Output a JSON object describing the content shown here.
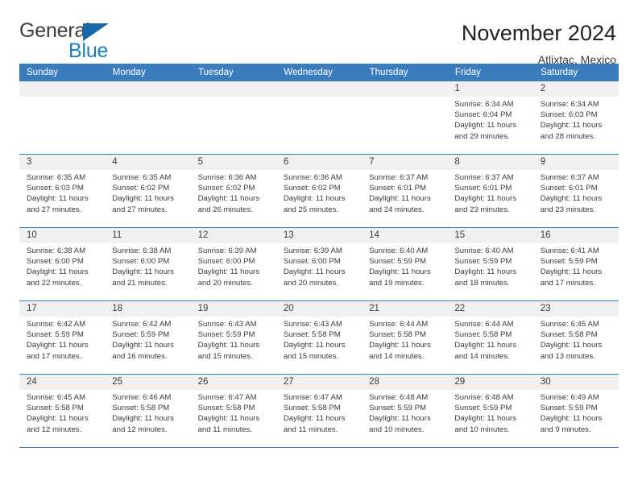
{
  "brand": {
    "name_part1": "General",
    "name_part2": "Blue",
    "accent_color": "#1b7fc4",
    "header_color": "#3b7cbd"
  },
  "header": {
    "title": "November 2024",
    "subtitle": "Atlixtac, Mexico"
  },
  "weekday_headers": [
    "Sunday",
    "Monday",
    "Tuesday",
    "Wednesday",
    "Thursday",
    "Friday",
    "Saturday"
  ],
  "weeks": [
    [
      {
        "date": "",
        "empty": true
      },
      {
        "date": "",
        "empty": true
      },
      {
        "date": "",
        "empty": true
      },
      {
        "date": "",
        "empty": true
      },
      {
        "date": "",
        "empty": true
      },
      {
        "date": "1",
        "sunrise": "Sunrise: 6:34 AM",
        "sunset": "Sunset: 6:04 PM",
        "daylight_line1": "Daylight: 11 hours",
        "daylight_line2": "and 29 minutes."
      },
      {
        "date": "2",
        "sunrise": "Sunrise: 6:34 AM",
        "sunset": "Sunset: 6:03 PM",
        "daylight_line1": "Daylight: 11 hours",
        "daylight_line2": "and 28 minutes."
      }
    ],
    [
      {
        "date": "3",
        "sunrise": "Sunrise: 6:35 AM",
        "sunset": "Sunset: 6:03 PM",
        "daylight_line1": "Daylight: 11 hours",
        "daylight_line2": "and 27 minutes."
      },
      {
        "date": "4",
        "sunrise": "Sunrise: 6:35 AM",
        "sunset": "Sunset: 6:02 PM",
        "daylight_line1": "Daylight: 11 hours",
        "daylight_line2": "and 27 minutes."
      },
      {
        "date": "5",
        "sunrise": "Sunrise: 6:36 AM",
        "sunset": "Sunset: 6:02 PM",
        "daylight_line1": "Daylight: 11 hours",
        "daylight_line2": "and 26 minutes."
      },
      {
        "date": "6",
        "sunrise": "Sunrise: 6:36 AM",
        "sunset": "Sunset: 6:02 PM",
        "daylight_line1": "Daylight: 11 hours",
        "daylight_line2": "and 25 minutes."
      },
      {
        "date": "7",
        "sunrise": "Sunrise: 6:37 AM",
        "sunset": "Sunset: 6:01 PM",
        "daylight_line1": "Daylight: 11 hours",
        "daylight_line2": "and 24 minutes."
      },
      {
        "date": "8",
        "sunrise": "Sunrise: 6:37 AM",
        "sunset": "Sunset: 6:01 PM",
        "daylight_line1": "Daylight: 11 hours",
        "daylight_line2": "and 23 minutes."
      },
      {
        "date": "9",
        "sunrise": "Sunrise: 6:37 AM",
        "sunset": "Sunset: 6:01 PM",
        "daylight_line1": "Daylight: 11 hours",
        "daylight_line2": "and 23 minutes."
      }
    ],
    [
      {
        "date": "10",
        "sunrise": "Sunrise: 6:38 AM",
        "sunset": "Sunset: 6:00 PM",
        "daylight_line1": "Daylight: 11 hours",
        "daylight_line2": "and 22 minutes."
      },
      {
        "date": "11",
        "sunrise": "Sunrise: 6:38 AM",
        "sunset": "Sunset: 6:00 PM",
        "daylight_line1": "Daylight: 11 hours",
        "daylight_line2": "and 21 minutes."
      },
      {
        "date": "12",
        "sunrise": "Sunrise: 6:39 AM",
        "sunset": "Sunset: 6:00 PM",
        "daylight_line1": "Daylight: 11 hours",
        "daylight_line2": "and 20 minutes."
      },
      {
        "date": "13",
        "sunrise": "Sunrise: 6:39 AM",
        "sunset": "Sunset: 6:00 PM",
        "daylight_line1": "Daylight: 11 hours",
        "daylight_line2": "and 20 minutes."
      },
      {
        "date": "14",
        "sunrise": "Sunrise: 6:40 AM",
        "sunset": "Sunset: 5:59 PM",
        "daylight_line1": "Daylight: 11 hours",
        "daylight_line2": "and 19 minutes."
      },
      {
        "date": "15",
        "sunrise": "Sunrise: 6:40 AM",
        "sunset": "Sunset: 5:59 PM",
        "daylight_line1": "Daylight: 11 hours",
        "daylight_line2": "and 18 minutes."
      },
      {
        "date": "16",
        "sunrise": "Sunrise: 6:41 AM",
        "sunset": "Sunset: 5:59 PM",
        "daylight_line1": "Daylight: 11 hours",
        "daylight_line2": "and 17 minutes."
      }
    ],
    [
      {
        "date": "17",
        "sunrise": "Sunrise: 6:42 AM",
        "sunset": "Sunset: 5:59 PM",
        "daylight_line1": "Daylight: 11 hours",
        "daylight_line2": "and 17 minutes."
      },
      {
        "date": "18",
        "sunrise": "Sunrise: 6:42 AM",
        "sunset": "Sunset: 5:59 PM",
        "daylight_line1": "Daylight: 11 hours",
        "daylight_line2": "and 16 minutes."
      },
      {
        "date": "19",
        "sunrise": "Sunrise: 6:43 AM",
        "sunset": "Sunset: 5:59 PM",
        "daylight_line1": "Daylight: 11 hours",
        "daylight_line2": "and 15 minutes."
      },
      {
        "date": "20",
        "sunrise": "Sunrise: 6:43 AM",
        "sunset": "Sunset: 5:58 PM",
        "daylight_line1": "Daylight: 11 hours",
        "daylight_line2": "and 15 minutes."
      },
      {
        "date": "21",
        "sunrise": "Sunrise: 6:44 AM",
        "sunset": "Sunset: 5:58 PM",
        "daylight_line1": "Daylight: 11 hours",
        "daylight_line2": "and 14 minutes."
      },
      {
        "date": "22",
        "sunrise": "Sunrise: 6:44 AM",
        "sunset": "Sunset: 5:58 PM",
        "daylight_line1": "Daylight: 11 hours",
        "daylight_line2": "and 14 minutes."
      },
      {
        "date": "23",
        "sunrise": "Sunrise: 6:45 AM",
        "sunset": "Sunset: 5:58 PM",
        "daylight_line1": "Daylight: 11 hours",
        "daylight_line2": "and 13 minutes."
      }
    ],
    [
      {
        "date": "24",
        "sunrise": "Sunrise: 6:45 AM",
        "sunset": "Sunset: 5:58 PM",
        "daylight_line1": "Daylight: 11 hours",
        "daylight_line2": "and 12 minutes."
      },
      {
        "date": "25",
        "sunrise": "Sunrise: 6:46 AM",
        "sunset": "Sunset: 5:58 PM",
        "daylight_line1": "Daylight: 11 hours",
        "daylight_line2": "and 12 minutes."
      },
      {
        "date": "26",
        "sunrise": "Sunrise: 6:47 AM",
        "sunset": "Sunset: 5:58 PM",
        "daylight_line1": "Daylight: 11 hours",
        "daylight_line2": "and 11 minutes."
      },
      {
        "date": "27",
        "sunrise": "Sunrise: 6:47 AM",
        "sunset": "Sunset: 5:58 PM",
        "daylight_line1": "Daylight: 11 hours",
        "daylight_line2": "and 11 minutes."
      },
      {
        "date": "28",
        "sunrise": "Sunrise: 6:48 AM",
        "sunset": "Sunset: 5:59 PM",
        "daylight_line1": "Daylight: 11 hours",
        "daylight_line2": "and 10 minutes."
      },
      {
        "date": "29",
        "sunrise": "Sunrise: 6:48 AM",
        "sunset": "Sunset: 5:59 PM",
        "daylight_line1": "Daylight: 11 hours",
        "daylight_line2": "and 10 minutes."
      },
      {
        "date": "30",
        "sunrise": "Sunrise: 6:49 AM",
        "sunset": "Sunset: 5:59 PM",
        "daylight_line1": "Daylight: 11 hours",
        "daylight_line2": "and 9 minutes."
      }
    ]
  ]
}
